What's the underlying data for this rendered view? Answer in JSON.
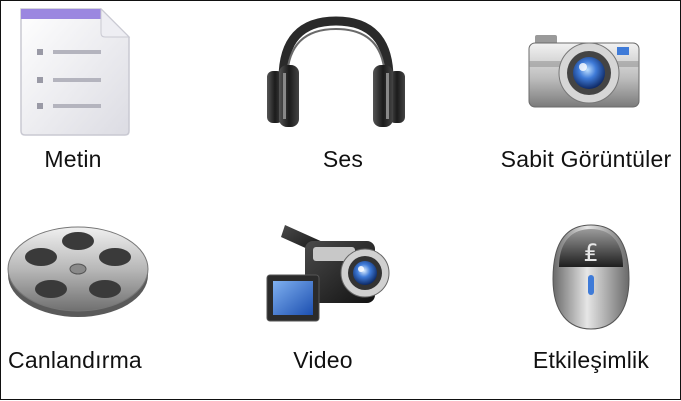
{
  "items": [
    {
      "label": "Metin",
      "icon": "document-text-icon"
    },
    {
      "label": "Ses",
      "icon": "headphones-icon"
    },
    {
      "label": "Sabit Görüntüler",
      "icon": "camera-icon"
    },
    {
      "label": "Canlandırma",
      "icon": "film-reel-icon"
    },
    {
      "label": "Video",
      "icon": "video-camera-icon"
    },
    {
      "label": "Etkileşimlik",
      "icon": "mouse-icon"
    }
  ],
  "colors": {
    "background": "#ffffff",
    "text": "#111111",
    "document_tab": "#9b87e0",
    "lens_blue": "#3f7bd8"
  }
}
